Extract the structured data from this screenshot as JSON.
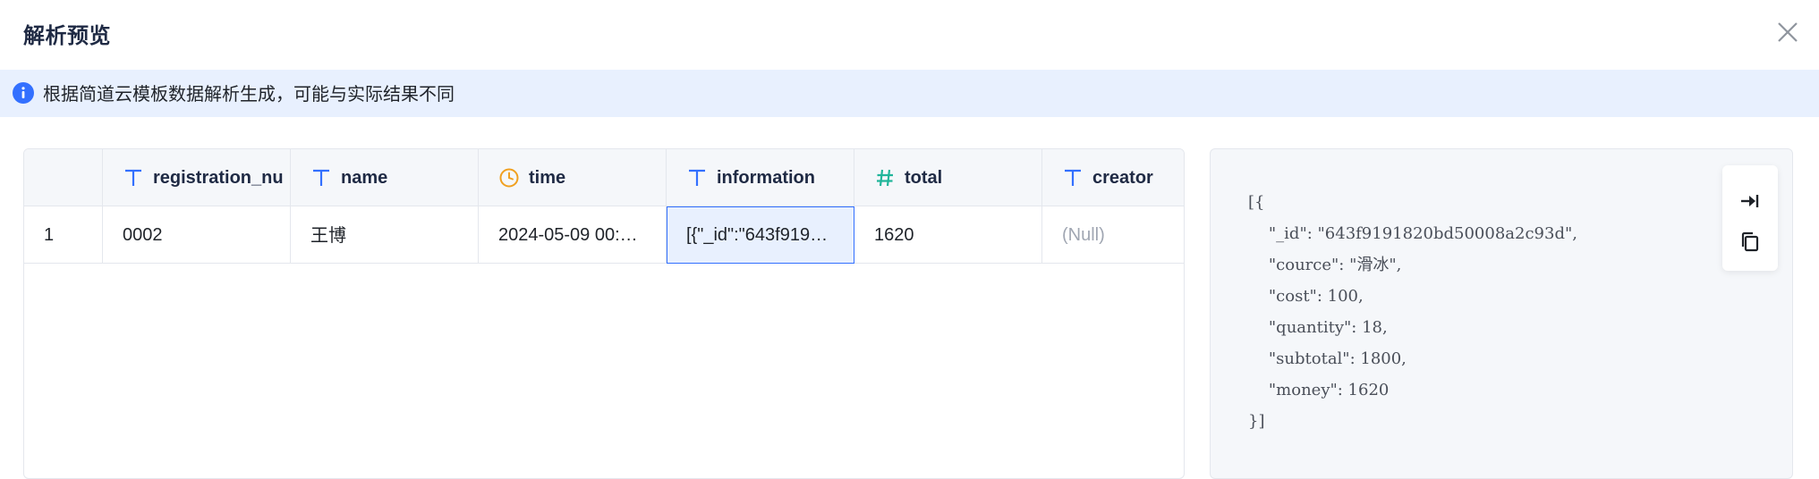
{
  "dialog": {
    "title": "解析预览",
    "close_icon": "close-icon"
  },
  "notice": {
    "icon": "info-icon",
    "text": "根据简道云模板数据解析生成，可能与实际结果不同"
  },
  "table": {
    "columns": [
      {
        "label": "",
        "type_icon": ""
      },
      {
        "label": "registration_nu",
        "type_icon": "text-type-icon"
      },
      {
        "label": "name",
        "type_icon": "text-type-icon"
      },
      {
        "label": "time",
        "type_icon": "clock-icon"
      },
      {
        "label": "information",
        "type_icon": "text-type-icon"
      },
      {
        "label": "total",
        "type_icon": "hash-icon"
      },
      {
        "label": "creator",
        "type_icon": "text-type-icon"
      }
    ],
    "rows": [
      {
        "row_number": "1",
        "registration_nu": "0002",
        "name": "王博",
        "time": "2024-05-09 00:…",
        "information": "[{\"_id\":\"643f919…",
        "total": "1620",
        "creator": "(Null)"
      }
    ]
  },
  "json_preview": {
    "lines": [
      "[{",
      "    \"_id\": \"643f9191820bd50008a2c93d\",",
      "    \"cource\": \"滑冰\",",
      "    \"cost\": 100,",
      "    \"quantity\": 18,",
      "    \"subtotal\": 1800,",
      "    \"money\": 1620",
      "}]"
    ],
    "tools": [
      "expand-icon",
      "copy-icon"
    ]
  },
  "colors": {
    "accent": "#3370ff",
    "notice_bg": "#e8f0fe",
    "clock": "#f0a020",
    "hash": "#20b59a"
  }
}
